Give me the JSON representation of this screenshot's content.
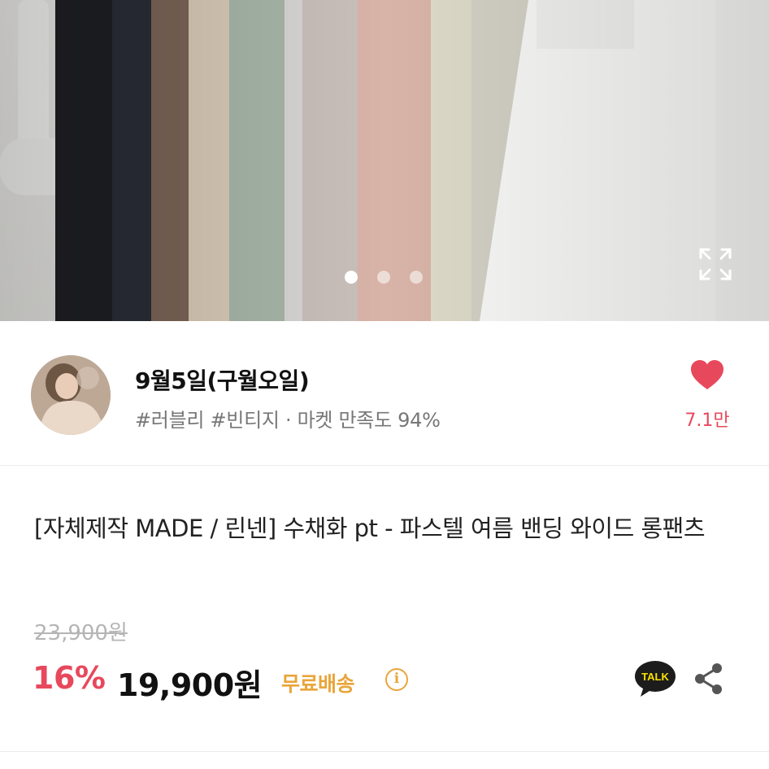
{
  "gallery": {
    "slide_count": 3,
    "active_index": 0,
    "expand_icon": "expand-icon"
  },
  "shop": {
    "name": "9월5일(구월오일)",
    "tags": "#러블리 #빈티지 · 마켓 만족도 94%",
    "favorite_icon": "heart-icon",
    "favorite_count": "7.1만"
  },
  "product": {
    "title": "[자체제작 MADE / 린넨] 수채화 pt - 파스텔 여름 밴딩 와이드 롱팬츠",
    "original_price": "23,900원",
    "discount": "16%",
    "price": "19,900원",
    "shipping": "무료배송",
    "shipping_info_icon": "info-icon",
    "talk_label": "TALK",
    "share_icon": "share-icon"
  },
  "colors": {
    "accent_red": "#e8485c",
    "shipping_orange": "#e9a53a",
    "talk_yellow": "#fae100"
  }
}
